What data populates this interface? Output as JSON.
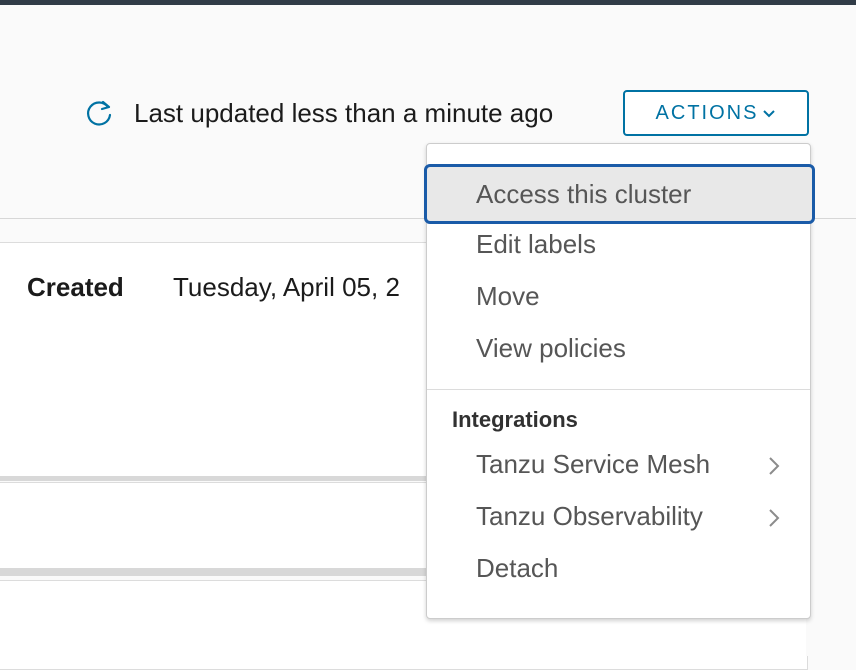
{
  "header": {
    "refresh_icon": "refresh-icon",
    "last_updated": "Last updated less than a minute ago",
    "actions_label": "ACTIONS",
    "actions_icon": "chevron-down-icon",
    "accent_color": "#0072a3"
  },
  "details": {
    "created_label": "Created",
    "created_value": "Tuesday, April 05, 2"
  },
  "menu": {
    "items": [
      {
        "label": "Access this cluster",
        "focused": true
      },
      {
        "label": "Edit labels"
      },
      {
        "label": "Move"
      },
      {
        "label": "View policies"
      }
    ],
    "group_header": "Integrations",
    "integration_items": [
      {
        "label": "Tanzu Service Mesh",
        "icon": "chevron-right-icon"
      },
      {
        "label": "Tanzu Observability",
        "icon": "chevron-right-icon"
      },
      {
        "label": "Detach"
      }
    ],
    "focus_color": "#1a5ba8"
  }
}
